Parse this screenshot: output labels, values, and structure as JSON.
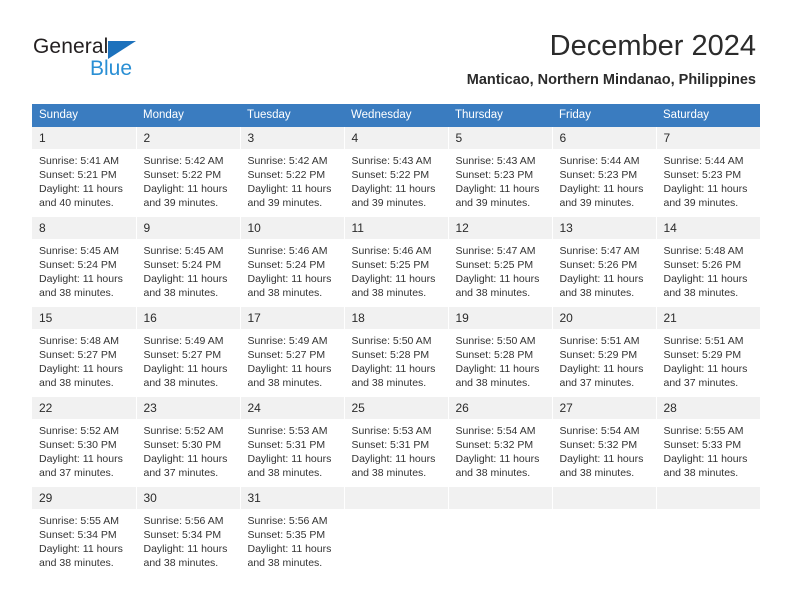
{
  "brand": {
    "name_part1": "General",
    "name_part2": "Blue",
    "triangle_color": "#1c71bc",
    "blue_color": "#2a8fd4"
  },
  "header": {
    "title": "December 2024",
    "subtitle": "Manticao, Northern Mindanao, Philippines"
  },
  "theme": {
    "header_bg": "#3a7cc0",
    "daynum_bg": "#f1f1f1",
    "text": "#333333"
  },
  "weekdays": [
    "Sunday",
    "Monday",
    "Tuesday",
    "Wednesday",
    "Thursday",
    "Friday",
    "Saturday"
  ],
  "weeks": [
    [
      {
        "day": "1",
        "sunrise": "Sunrise: 5:41 AM",
        "sunset": "Sunset: 5:21 PM",
        "daylight_line1": "Daylight: 11 hours",
        "daylight_line2": "and 40 minutes."
      },
      {
        "day": "2",
        "sunrise": "Sunrise: 5:42 AM",
        "sunset": "Sunset: 5:22 PM",
        "daylight_line1": "Daylight: 11 hours",
        "daylight_line2": "and 39 minutes."
      },
      {
        "day": "3",
        "sunrise": "Sunrise: 5:42 AM",
        "sunset": "Sunset: 5:22 PM",
        "daylight_line1": "Daylight: 11 hours",
        "daylight_line2": "and 39 minutes."
      },
      {
        "day": "4",
        "sunrise": "Sunrise: 5:43 AM",
        "sunset": "Sunset: 5:22 PM",
        "daylight_line1": "Daylight: 11 hours",
        "daylight_line2": "and 39 minutes."
      },
      {
        "day": "5",
        "sunrise": "Sunrise: 5:43 AM",
        "sunset": "Sunset: 5:23 PM",
        "daylight_line1": "Daylight: 11 hours",
        "daylight_line2": "and 39 minutes."
      },
      {
        "day": "6",
        "sunrise": "Sunrise: 5:44 AM",
        "sunset": "Sunset: 5:23 PM",
        "daylight_line1": "Daylight: 11 hours",
        "daylight_line2": "and 39 minutes."
      },
      {
        "day": "7",
        "sunrise": "Sunrise: 5:44 AM",
        "sunset": "Sunset: 5:23 PM",
        "daylight_line1": "Daylight: 11 hours",
        "daylight_line2": "and 39 minutes."
      }
    ],
    [
      {
        "day": "8",
        "sunrise": "Sunrise: 5:45 AM",
        "sunset": "Sunset: 5:24 PM",
        "daylight_line1": "Daylight: 11 hours",
        "daylight_line2": "and 38 minutes."
      },
      {
        "day": "9",
        "sunrise": "Sunrise: 5:45 AM",
        "sunset": "Sunset: 5:24 PM",
        "daylight_line1": "Daylight: 11 hours",
        "daylight_line2": "and 38 minutes."
      },
      {
        "day": "10",
        "sunrise": "Sunrise: 5:46 AM",
        "sunset": "Sunset: 5:24 PM",
        "daylight_line1": "Daylight: 11 hours",
        "daylight_line2": "and 38 minutes."
      },
      {
        "day": "11",
        "sunrise": "Sunrise: 5:46 AM",
        "sunset": "Sunset: 5:25 PM",
        "daylight_line1": "Daylight: 11 hours",
        "daylight_line2": "and 38 minutes."
      },
      {
        "day": "12",
        "sunrise": "Sunrise: 5:47 AM",
        "sunset": "Sunset: 5:25 PM",
        "daylight_line1": "Daylight: 11 hours",
        "daylight_line2": "and 38 minutes."
      },
      {
        "day": "13",
        "sunrise": "Sunrise: 5:47 AM",
        "sunset": "Sunset: 5:26 PM",
        "daylight_line1": "Daylight: 11 hours",
        "daylight_line2": "and 38 minutes."
      },
      {
        "day": "14",
        "sunrise": "Sunrise: 5:48 AM",
        "sunset": "Sunset: 5:26 PM",
        "daylight_line1": "Daylight: 11 hours",
        "daylight_line2": "and 38 minutes."
      }
    ],
    [
      {
        "day": "15",
        "sunrise": "Sunrise: 5:48 AM",
        "sunset": "Sunset: 5:27 PM",
        "daylight_line1": "Daylight: 11 hours",
        "daylight_line2": "and 38 minutes."
      },
      {
        "day": "16",
        "sunrise": "Sunrise: 5:49 AM",
        "sunset": "Sunset: 5:27 PM",
        "daylight_line1": "Daylight: 11 hours",
        "daylight_line2": "and 38 minutes."
      },
      {
        "day": "17",
        "sunrise": "Sunrise: 5:49 AM",
        "sunset": "Sunset: 5:27 PM",
        "daylight_line1": "Daylight: 11 hours",
        "daylight_line2": "and 38 minutes."
      },
      {
        "day": "18",
        "sunrise": "Sunrise: 5:50 AM",
        "sunset": "Sunset: 5:28 PM",
        "daylight_line1": "Daylight: 11 hours",
        "daylight_line2": "and 38 minutes."
      },
      {
        "day": "19",
        "sunrise": "Sunrise: 5:50 AM",
        "sunset": "Sunset: 5:28 PM",
        "daylight_line1": "Daylight: 11 hours",
        "daylight_line2": "and 38 minutes."
      },
      {
        "day": "20",
        "sunrise": "Sunrise: 5:51 AM",
        "sunset": "Sunset: 5:29 PM",
        "daylight_line1": "Daylight: 11 hours",
        "daylight_line2": "and 37 minutes."
      },
      {
        "day": "21",
        "sunrise": "Sunrise: 5:51 AM",
        "sunset": "Sunset: 5:29 PM",
        "daylight_line1": "Daylight: 11 hours",
        "daylight_line2": "and 37 minutes."
      }
    ],
    [
      {
        "day": "22",
        "sunrise": "Sunrise: 5:52 AM",
        "sunset": "Sunset: 5:30 PM",
        "daylight_line1": "Daylight: 11 hours",
        "daylight_line2": "and 37 minutes."
      },
      {
        "day": "23",
        "sunrise": "Sunrise: 5:52 AM",
        "sunset": "Sunset: 5:30 PM",
        "daylight_line1": "Daylight: 11 hours",
        "daylight_line2": "and 37 minutes."
      },
      {
        "day": "24",
        "sunrise": "Sunrise: 5:53 AM",
        "sunset": "Sunset: 5:31 PM",
        "daylight_line1": "Daylight: 11 hours",
        "daylight_line2": "and 38 minutes."
      },
      {
        "day": "25",
        "sunrise": "Sunrise: 5:53 AM",
        "sunset": "Sunset: 5:31 PM",
        "daylight_line1": "Daylight: 11 hours",
        "daylight_line2": "and 38 minutes."
      },
      {
        "day": "26",
        "sunrise": "Sunrise: 5:54 AM",
        "sunset": "Sunset: 5:32 PM",
        "daylight_line1": "Daylight: 11 hours",
        "daylight_line2": "and 38 minutes."
      },
      {
        "day": "27",
        "sunrise": "Sunrise: 5:54 AM",
        "sunset": "Sunset: 5:32 PM",
        "daylight_line1": "Daylight: 11 hours",
        "daylight_line2": "and 38 minutes."
      },
      {
        "day": "28",
        "sunrise": "Sunrise: 5:55 AM",
        "sunset": "Sunset: 5:33 PM",
        "daylight_line1": "Daylight: 11 hours",
        "daylight_line2": "and 38 minutes."
      }
    ],
    [
      {
        "day": "29",
        "sunrise": "Sunrise: 5:55 AM",
        "sunset": "Sunset: 5:34 PM",
        "daylight_line1": "Daylight: 11 hours",
        "daylight_line2": "and 38 minutes."
      },
      {
        "day": "30",
        "sunrise": "Sunrise: 5:56 AM",
        "sunset": "Sunset: 5:34 PM",
        "daylight_line1": "Daylight: 11 hours",
        "daylight_line2": "and 38 minutes."
      },
      {
        "day": "31",
        "sunrise": "Sunrise: 5:56 AM",
        "sunset": "Sunset: 5:35 PM",
        "daylight_line1": "Daylight: 11 hours",
        "daylight_line2": "and 38 minutes."
      },
      {
        "day": "",
        "sunrise": "",
        "sunset": "",
        "daylight_line1": "",
        "daylight_line2": ""
      },
      {
        "day": "",
        "sunrise": "",
        "sunset": "",
        "daylight_line1": "",
        "daylight_line2": ""
      },
      {
        "day": "",
        "sunrise": "",
        "sunset": "",
        "daylight_line1": "",
        "daylight_line2": ""
      },
      {
        "day": "",
        "sunrise": "",
        "sunset": "",
        "daylight_line1": "",
        "daylight_line2": ""
      }
    ]
  ]
}
